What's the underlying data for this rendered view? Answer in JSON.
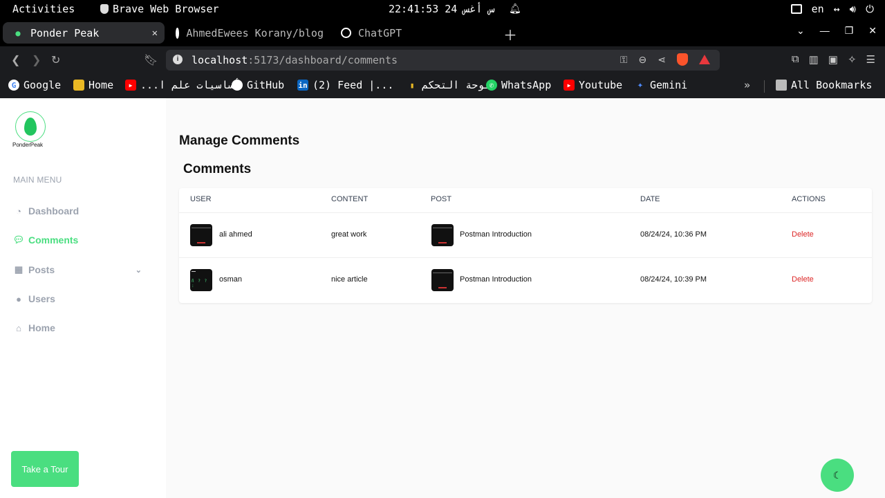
{
  "system_bar": {
    "activities": "Activities",
    "app_name": "Brave Web Browser",
    "clock": "22:41:53 24 س أغس",
    "lang": "en"
  },
  "tabs": [
    {
      "title": "Ponder Peak",
      "active": true
    },
    {
      "title": "AhmedEwees Korany/blog",
      "active": false
    },
    {
      "title": "ChatGPT",
      "active": false
    }
  ],
  "address": {
    "host": "localhost",
    "path": ":5173/dashboard/comments"
  },
  "bookmarks": [
    {
      "label": "Google",
      "icon": "google-icon"
    },
    {
      "label": "Home",
      "icon": "home-folder-icon"
    },
    {
      "label": "أساسيات علم ا...",
      "icon": "youtube-icon"
    },
    {
      "label": "GitHub",
      "icon": "github-icon"
    },
    {
      "label": "(2) Feed |...",
      "icon": "linkedin-icon"
    },
    {
      "label": "لوحة التحكم",
      "icon": "dashboard-icon"
    },
    {
      "label": "WhatsApp",
      "icon": "whatsapp-icon"
    },
    {
      "label": "Youtube",
      "icon": "youtube-icon"
    },
    {
      "label": "Gemini",
      "icon": "gemini-icon"
    },
    {
      "label": "All Bookmarks",
      "icon": "folder-icon"
    }
  ],
  "sidebar": {
    "logo_text": "PonderPeak",
    "menu_title": "MAIN MENU",
    "items": [
      {
        "label": "Dashboard",
        "icon": "gauge-icon",
        "active": false
      },
      {
        "label": "Comments",
        "icon": "comments-icon",
        "active": true
      },
      {
        "label": "Posts",
        "icon": "grid-icon",
        "active": false
      },
      {
        "label": "Users",
        "icon": "user-icon",
        "active": false
      },
      {
        "label": "Home",
        "icon": "home-icon",
        "active": false
      }
    ],
    "tour_button": "Take a Tour"
  },
  "main": {
    "page_title": "Manage Comments",
    "section_title": "Comments",
    "columns": [
      "USER",
      "CONTENT",
      "POST",
      "DATE",
      "ACTIONS"
    ],
    "rows": [
      {
        "user": "ali ahmed",
        "content": "great work",
        "post": "Postman Introduction",
        "date": "08/24/24, 10:36 PM",
        "action": "Delete"
      },
      {
        "user": "osman",
        "content": "nice article",
        "post": "Postman Introduction",
        "date": "08/24/24, 10:39 PM",
        "action": "Delete"
      }
    ]
  },
  "colors": {
    "accent": "#4ade80",
    "danger": "#dc2626"
  }
}
